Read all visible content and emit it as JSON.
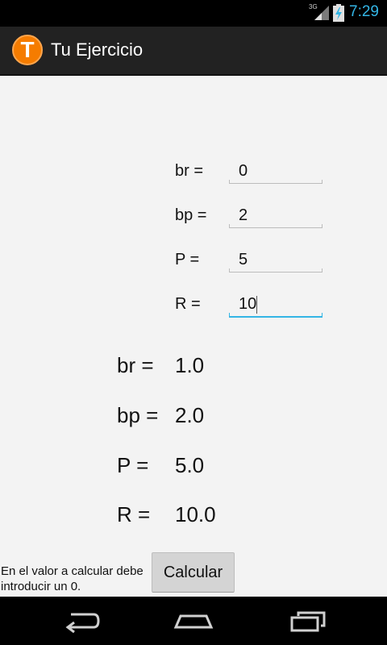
{
  "status_bar": {
    "network_type": "3G",
    "clock": "7:29",
    "icons": [
      "signal-icon",
      "battery-charging-icon"
    ]
  },
  "action_bar": {
    "app_icon_letter": "T",
    "title": "Tu Ejercicio"
  },
  "inputs": [
    {
      "label": "br =",
      "value": "0"
    },
    {
      "label": "bp =",
      "value": "2"
    },
    {
      "label": "P =",
      "value": "5"
    },
    {
      "label": "R =",
      "value": "10",
      "focused": true
    }
  ],
  "results": [
    {
      "label": "br =",
      "value": "1.0"
    },
    {
      "label": "bp =",
      "value": "2.0"
    },
    {
      "label": "P =",
      "value": "5.0"
    },
    {
      "label": "R =",
      "value": "10.0"
    }
  ],
  "note": "En el valor a calcular debe introducir un 0.",
  "calculate_button": "Calcular",
  "nav_bar": {
    "icons": [
      "back-icon",
      "home-icon",
      "recent-apps-icon"
    ]
  },
  "colors": {
    "accent": "#33b5e5",
    "app_icon": "#f57c00",
    "action_bar": "#222222",
    "background": "#f3f3f3"
  }
}
